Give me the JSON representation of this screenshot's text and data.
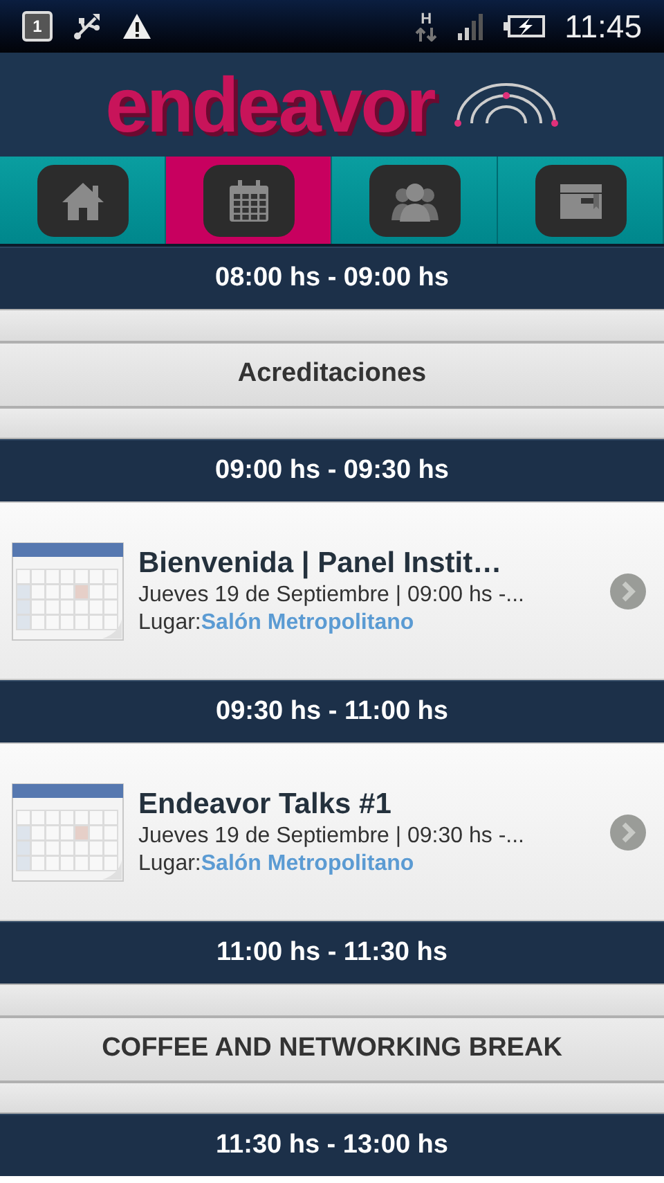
{
  "status_bar": {
    "notification_count": "1",
    "network": "H",
    "time": "11:45"
  },
  "header": {
    "logo": "endeavor"
  },
  "tabs": [
    {
      "selected": false
    },
    {
      "selected": true
    },
    {
      "selected": false
    },
    {
      "selected": false
    }
  ],
  "agenda": [
    {
      "kind": "time",
      "text": "08:00 hs - 09:00 hs"
    },
    {
      "kind": "session",
      "text": "Acreditaciones"
    },
    {
      "kind": "time",
      "text": "09:00 hs - 09:30 hs"
    },
    {
      "kind": "event",
      "title": "Bienvenida | Panel Instit…",
      "details": "Jueves 19 de Septiembre | 09:00 hs -...",
      "location_label": "Lugar:",
      "location": "Salón Metropolitano"
    },
    {
      "kind": "time",
      "text": "09:30 hs - 11:00 hs"
    },
    {
      "kind": "event",
      "title": "Endeavor Talks #1",
      "details": "Jueves 19 de Septiembre | 09:30 hs -...",
      "location_label": "Lugar:",
      "location": "Salón Metropolitano"
    },
    {
      "kind": "time",
      "text": "11:00 hs - 11:30 hs"
    },
    {
      "kind": "session",
      "text": "COFFEE AND NETWORKING BREAK"
    },
    {
      "kind": "time",
      "text": "11:30 hs - 13:00 hs"
    }
  ]
}
